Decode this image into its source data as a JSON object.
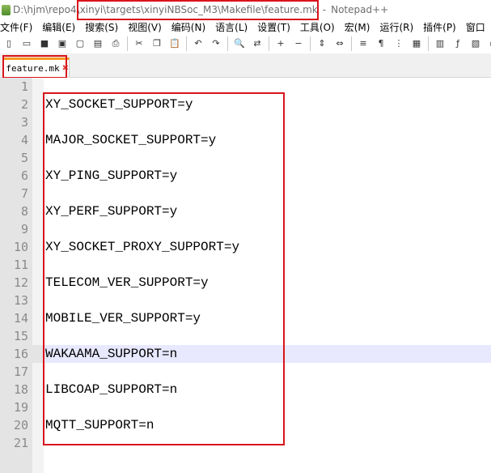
{
  "window": {
    "title_path_prefix": "D:\\hjm\\repo4\\",
    "title_path_highlight": "xinyi\\targets\\xinyiNBSoc_M3\\Makefile\\feature.mk",
    "title_separator": "-",
    "app_name": "Notepad++"
  },
  "menu": {
    "items": [
      {
        "label": "文件(F)"
      },
      {
        "label": "编辑(E)"
      },
      {
        "label": "搜索(S)"
      },
      {
        "label": "视图(V)"
      },
      {
        "label": "编码(N)"
      },
      {
        "label": "语言(L)"
      },
      {
        "label": "设置(T)"
      },
      {
        "label": "工具(O)"
      },
      {
        "label": "宏(M)"
      },
      {
        "label": "运行(R)"
      },
      {
        "label": "插件(P)"
      },
      {
        "label": "窗口"
      }
    ]
  },
  "toolbar": {
    "buttons": [
      {
        "icon": "new-file-icon",
        "glyph": "▯"
      },
      {
        "icon": "open-file-icon",
        "glyph": "▭"
      },
      {
        "icon": "save-icon",
        "glyph": "■"
      },
      {
        "icon": "save-all-icon",
        "glyph": "▣"
      },
      {
        "icon": "close-icon",
        "glyph": "▢"
      },
      {
        "icon": "close-all-icon",
        "glyph": "▤"
      },
      {
        "icon": "print-icon",
        "glyph": "⎙"
      },
      {
        "icon": "cut-icon",
        "glyph": "✂"
      },
      {
        "icon": "copy-icon",
        "glyph": "❐"
      },
      {
        "icon": "paste-icon",
        "glyph": "📋"
      },
      {
        "icon": "undo-icon",
        "glyph": "↶"
      },
      {
        "icon": "redo-icon",
        "glyph": "↷"
      },
      {
        "icon": "find-icon",
        "glyph": "🔍"
      },
      {
        "icon": "replace-icon",
        "glyph": "⇄"
      },
      {
        "icon": "zoom-in-icon",
        "glyph": "+"
      },
      {
        "icon": "zoom-out-icon",
        "glyph": "−"
      },
      {
        "icon": "sync-vertical-icon",
        "glyph": "⇕"
      },
      {
        "icon": "sync-horizontal-icon",
        "glyph": "⇔"
      },
      {
        "icon": "word-wrap-icon",
        "glyph": "≡"
      },
      {
        "icon": "show-all-chars-icon",
        "glyph": "¶"
      },
      {
        "icon": "indent-guide-icon",
        "glyph": "⋮"
      },
      {
        "icon": "user-language-icon",
        "glyph": "▦"
      },
      {
        "icon": "document-map-icon",
        "glyph": "▥"
      },
      {
        "icon": "function-list-icon",
        "glyph": "ƒ"
      },
      {
        "icon": "folder-workspace-icon",
        "glyph": "▧"
      },
      {
        "icon": "monitoring-icon",
        "glyph": "◉"
      }
    ]
  },
  "tabs": [
    {
      "label": "feature.mk",
      "close": "✖"
    }
  ],
  "editor": {
    "current_line": 16,
    "lines": [
      {
        "number": "1",
        "text": ""
      },
      {
        "number": "2",
        "text": "XY_SOCKET_SUPPORT=y"
      },
      {
        "number": "3",
        "text": ""
      },
      {
        "number": "4",
        "text": "MAJOR_SOCKET_SUPPORT=y"
      },
      {
        "number": "5",
        "text": ""
      },
      {
        "number": "6",
        "text": "XY_PING_SUPPORT=y"
      },
      {
        "number": "7",
        "text": ""
      },
      {
        "number": "8",
        "text": "XY_PERF_SUPPORT=y"
      },
      {
        "number": "9",
        "text": ""
      },
      {
        "number": "10",
        "text": "XY_SOCKET_PROXY_SUPPORT=y"
      },
      {
        "number": "11",
        "text": ""
      },
      {
        "number": "12",
        "text": "TELECOM_VER_SUPPORT=y"
      },
      {
        "number": "13",
        "text": ""
      },
      {
        "number": "14",
        "text": "MOBILE_VER_SUPPORT=y"
      },
      {
        "number": "15",
        "text": ""
      },
      {
        "number": "16",
        "text": "WAKAAMA_SUPPORT=n"
      },
      {
        "number": "17",
        "text": ""
      },
      {
        "number": "18",
        "text": "LIBCOAP_SUPPORT=n"
      },
      {
        "number": "19",
        "text": ""
      },
      {
        "number": "20",
        "text": "MQTT_SUPPORT=n"
      },
      {
        "number": "21",
        "text": ""
      }
    ]
  },
  "colors": {
    "annotation_box": "#d9141c",
    "current_line_highlight": "#e8e8ff",
    "gutter": "#e4e4e4",
    "tab_accent": "#f59a23"
  }
}
